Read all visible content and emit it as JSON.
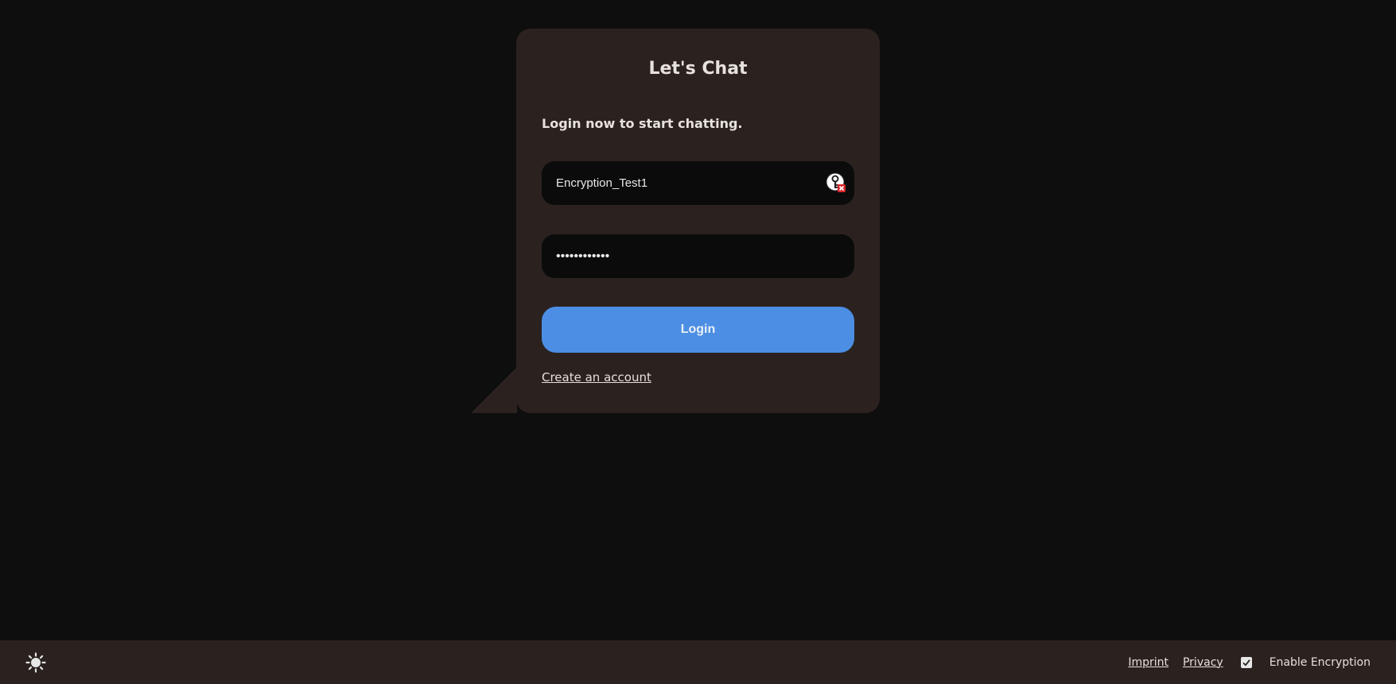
{
  "login_card": {
    "title": "Let's Chat",
    "subtitle": "Login now to start chatting.",
    "username_value": "Encryption_Test1",
    "password_value": "••••••••••••",
    "login_label": "Login",
    "create_account_label": "Create an account",
    "password_manager_icon": "key-icon"
  },
  "footer": {
    "theme_icon": "sun-icon",
    "imprint_label": "Imprint",
    "privacy_label": "Privacy",
    "encryption_checked": true,
    "encryption_label": "Enable Encryption"
  },
  "colors": {
    "background": "#0e0e0e",
    "card": "#2b2220",
    "input": "#0b0b0b",
    "accent": "#4c8ee3"
  }
}
